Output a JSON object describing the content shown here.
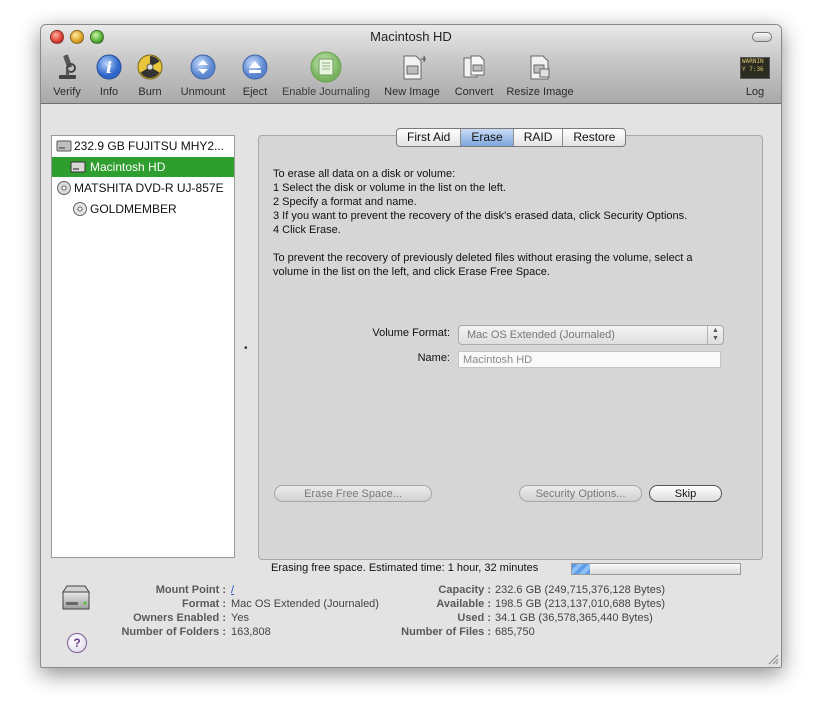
{
  "window": {
    "title": "Macintosh HD"
  },
  "toolbar": {
    "verify": "Verify",
    "info": "Info",
    "burn": "Burn",
    "unmount": "Unmount",
    "eject": "Eject",
    "enable_journaling": "Enable Journaling",
    "new_image": "New Image",
    "convert": "Convert",
    "resize_image": "Resize Image",
    "log": "Log",
    "log_icon_text": "WARNIN\nY 7:36"
  },
  "sidebar": {
    "items": [
      {
        "label": "232.9 GB FUJITSU MHY2...",
        "icon": "hard-drive-icon"
      },
      {
        "label": "Macintosh HD",
        "icon": "volume-icon",
        "selected": true
      },
      {
        "label": "MATSHITA DVD-R UJ-857E",
        "icon": "optical-drive-icon"
      },
      {
        "label": "GOLDMEMBER",
        "icon": "disc-icon"
      }
    ]
  },
  "tabs": [
    "First Aid",
    "Erase",
    "RAID",
    "Restore"
  ],
  "active_tab": "Erase",
  "instructions": {
    "line1": "To erase all data on a disk or volume:",
    "line2": "1 Select the disk or volume in the list on the left.",
    "line3": "2 Specify a format and name.",
    "line4": "3 If you want to prevent the recovery of the disk's erased data, click Security Options.",
    "line5": "4 Click Erase.",
    "line6": "To prevent the recovery of previously deleted files without erasing the volume, select a",
    "line7": "volume in the list on the left, and click Erase Free Space."
  },
  "form": {
    "volume_format_label": "Volume Format:",
    "volume_format_value": "Mac OS Extended (Journaled)",
    "name_label": "Name:",
    "name_value": "Macintosh HD"
  },
  "buttons": {
    "erase_free_space": "Erase Free Space...",
    "security_options": "Security Options...",
    "skip": "Skip"
  },
  "progress": {
    "text": "Erasing free space. Estimated time: 1 hour, 32 minutes",
    "fraction": 0.11
  },
  "info": {
    "mount_point_label": "Mount Point :",
    "mount_point_value": "/",
    "format_label": "Format :",
    "format_value": "Mac OS Extended (Journaled)",
    "owners_label": "Owners Enabled :",
    "owners_value": "Yes",
    "folders_label": "Number of Folders :",
    "folders_value": "163,808",
    "capacity_label": "Capacity :",
    "capacity_value": "232.6 GB (249,715,376,128 Bytes)",
    "available_label": "Available :",
    "available_value": "198.5 GB (213,137,010,688 Bytes)",
    "used_label": "Used :",
    "used_value": "34.1 GB (36,578,365,440 Bytes)",
    "files_label": "Number of Files :",
    "files_value": "685,750"
  },
  "help": {
    "glyph": "?"
  },
  "splitter": {
    "glyph": "•"
  },
  "colors": {
    "selection": "#2e9e2e",
    "active_tab": "#7ea6dc",
    "progress": "#5f9de6"
  }
}
